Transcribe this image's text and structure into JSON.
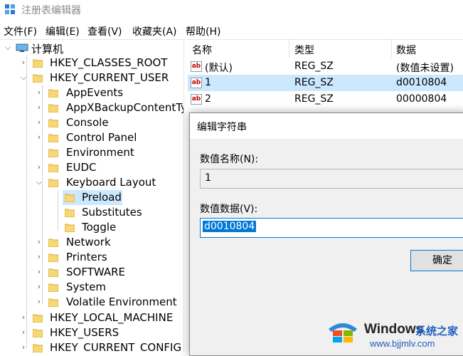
{
  "window": {
    "title": "注册表编辑器"
  },
  "menu": [
    "文件(F)",
    "编辑(E)",
    "查看(V)",
    "收藏夹(A)",
    "帮助(H)"
  ],
  "tree": {
    "root": "计算机",
    "items": [
      {
        "label": "HKEY_CLASSES_ROOT"
      },
      {
        "label": "HKEY_CURRENT_USER"
      },
      {
        "label": "AppEvents"
      },
      {
        "label": "AppXBackupContentTy"
      },
      {
        "label": "Console"
      },
      {
        "label": "Control Panel"
      },
      {
        "label": "Environment"
      },
      {
        "label": "EUDC"
      },
      {
        "label": "Keyboard Layout"
      },
      {
        "label": "Preload"
      },
      {
        "label": "Substitutes"
      },
      {
        "label": "Toggle"
      },
      {
        "label": "Network"
      },
      {
        "label": "Printers"
      },
      {
        "label": "SOFTWARE"
      },
      {
        "label": "System"
      },
      {
        "label": "Volatile Environment"
      },
      {
        "label": "HKEY_LOCAL_MACHINE"
      },
      {
        "label": "HKEY_USERS"
      },
      {
        "label": "HKEY_CURRENT_CONFIG"
      }
    ]
  },
  "list": {
    "columns": [
      "名称",
      "类型",
      "数据"
    ],
    "rows": [
      {
        "name": "(默认)",
        "type": "REG_SZ",
        "data": "(数值未设置)",
        "icon": "ab"
      },
      {
        "name": "1",
        "type": "REG_SZ",
        "data": "d0010804",
        "icon": "ab"
      },
      {
        "name": "2",
        "type": "REG_SZ",
        "data": "00000804",
        "icon": "ab"
      }
    ]
  },
  "dialog": {
    "title": "编辑字符串",
    "name_label": "数值名称(N):",
    "name_value": "1",
    "data_label": "数值数据(V):",
    "data_value": "d0010804",
    "ok_label": "确定"
  },
  "watermark": {
    "brand": "Windows",
    "cn": "系统之家",
    "url": "www.bjjmlv.com"
  },
  "colors": {
    "selection": "#cce8ff",
    "accent": "#0078d7",
    "folder": "#f8d775"
  }
}
